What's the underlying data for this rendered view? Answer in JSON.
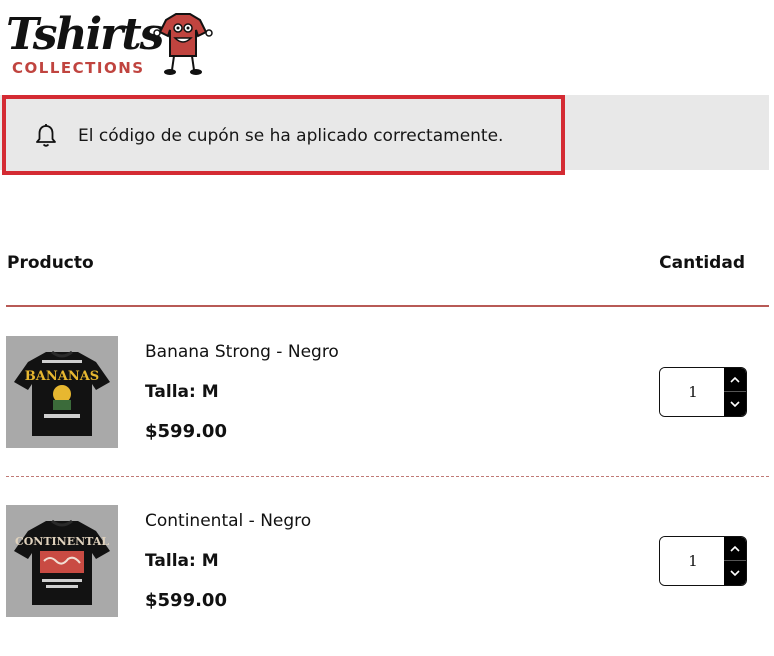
{
  "brand": {
    "logo_text": "Tshirts",
    "logo_sub": "COLLECTIONS"
  },
  "notice": {
    "icon": "bell-icon",
    "message": "El código de cupón se ha aplicado correctamente."
  },
  "table": {
    "headers": {
      "product": "Producto",
      "quantity": "Cantidad"
    },
    "items": [
      {
        "name": "Banana Strong - Negro",
        "size": "Talla: M",
        "price": "$599.00",
        "quantity": "1",
        "thumb_icon": "tshirt-bananas-image"
      },
      {
        "name": "Continental - Negro",
        "size": "Talla: M",
        "price": "$599.00",
        "quantity": "1",
        "thumb_icon": "tshirt-continental-image"
      }
    ]
  },
  "colors": {
    "accent_red": "#d42b33",
    "rule": "#b85a56",
    "brand_red": "#c0443f",
    "notice_bg": "#e8e8e8"
  }
}
